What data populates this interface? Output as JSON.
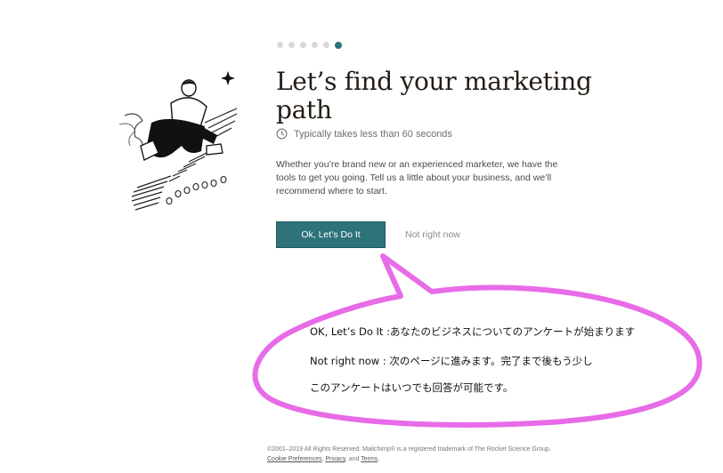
{
  "progress": {
    "total_steps": 6,
    "current_step": 6
  },
  "main": {
    "title": "Let’s find your marketing path",
    "timing": "Typically takes less than 60 seconds",
    "description": "Whether you’re brand new or an experienced marketer, we have the tools to get you going. Tell us a little about your business, and we’ll recommend where to start.",
    "primary_button": "Ok, Let’s Do It",
    "secondary_link": "Not right now"
  },
  "annotation": {
    "line1": "OK, Let’s Do It :あなたのビジネスについてのアンケートが始まります",
    "line2": "Not right now :  次のページに進みます。完了まで後もう少し",
    "line3": "このアンケートはいつでも回答が可能です。"
  },
  "footer": {
    "copyright": "©2001–2019 All Rights Reserved. Mailchimp® is a registered trademark of The Rocket Science Group.",
    "cookie_link": "Cookie Preferences",
    "sep1": ", ",
    "privacy_link": "Privacy",
    "sep2": ", and ",
    "terms_link": "Terms",
    "end": "."
  },
  "colors": {
    "accent": "#2d7379",
    "annotation_border": "#e86be8",
    "dot_inactive": "#d8d8d8"
  },
  "icons": [
    "clock-icon",
    "sparkle-icon"
  ]
}
